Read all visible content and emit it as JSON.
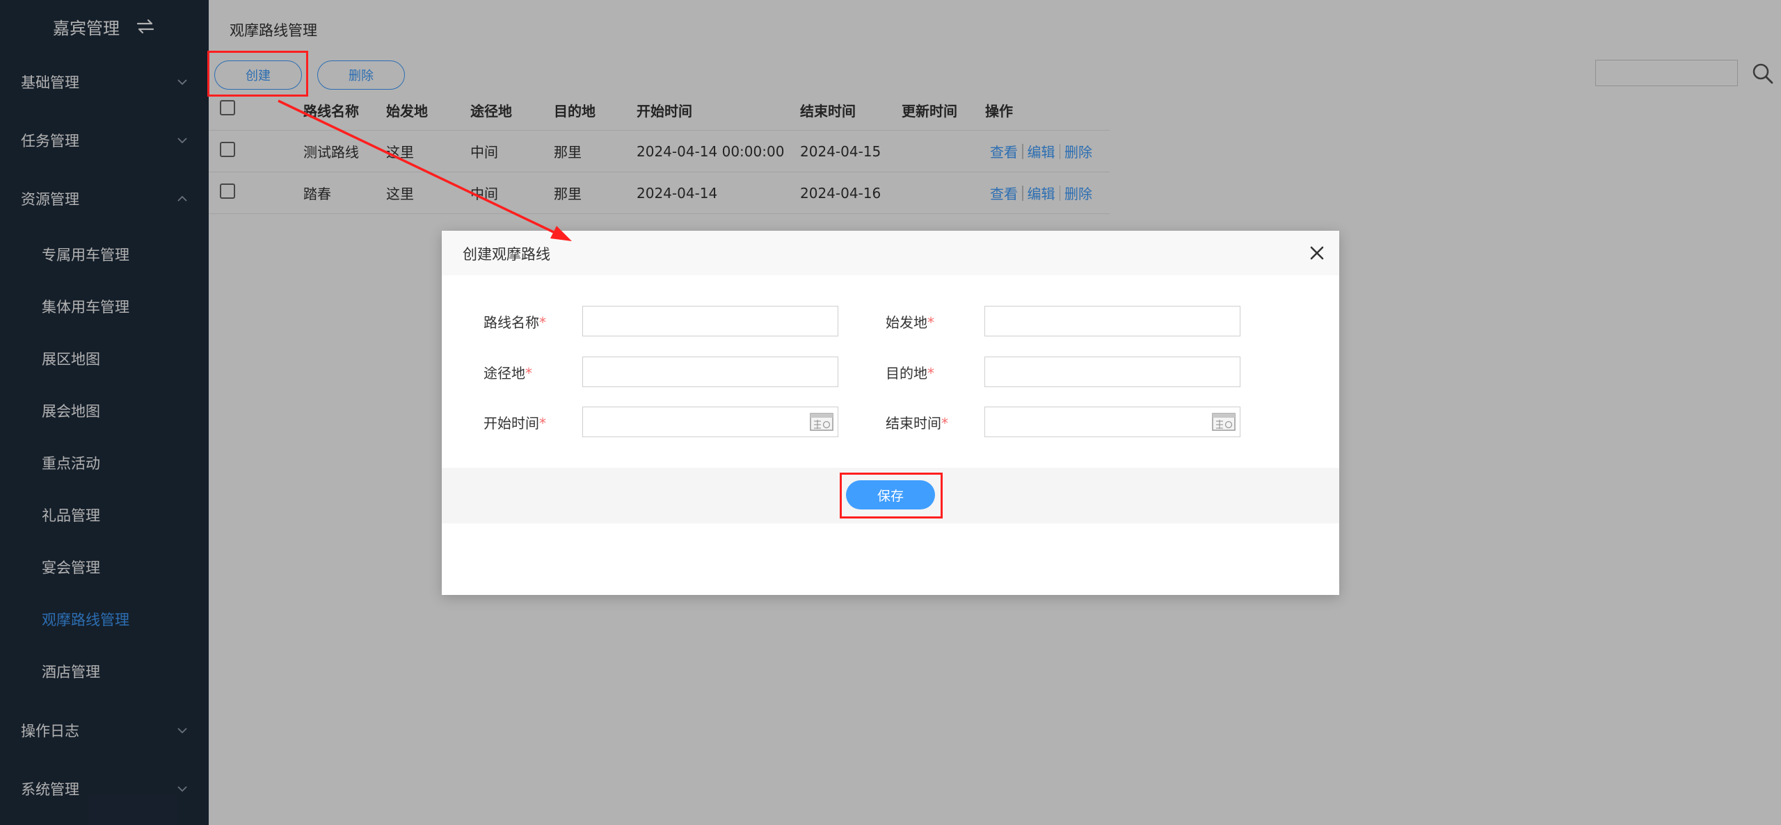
{
  "sidebar": {
    "brand": "嘉宾管理",
    "menu": [
      {
        "label": "基础管理"
      },
      {
        "label": "任务管理"
      },
      {
        "label": "资源管理"
      }
    ],
    "resource_items": [
      {
        "label": "专属用车管理"
      },
      {
        "label": "集体用车管理"
      },
      {
        "label": "展区地图"
      },
      {
        "label": "展会地图"
      },
      {
        "label": "重点活动"
      },
      {
        "label": "礼品管理"
      },
      {
        "label": "宴会管理"
      },
      {
        "label": "观摩路线管理"
      },
      {
        "label": "酒店管理"
      }
    ],
    "bottom_menu": [
      {
        "label": "操作日志"
      },
      {
        "label": "系统管理"
      }
    ]
  },
  "page": {
    "title": "观摩路线管理",
    "create_label": "创建",
    "delete_label": "删除",
    "search_value": ""
  },
  "table": {
    "headers": [
      "路线名称",
      "始发地",
      "途径地",
      "目的地",
      "开始时间",
      "结束时间",
      "更新时间",
      "操作"
    ],
    "rows": [
      [
        "测试路线",
        "这里",
        "中间",
        "那里",
        "2024-04-14 00:00:00",
        "2024-04-15",
        ""
      ],
      [
        "踏春",
        "这里",
        "中间",
        "那里",
        "2024-04-14",
        "2024-04-16",
        ""
      ]
    ],
    "actions": [
      "查看",
      "编辑",
      "删除"
    ]
  },
  "modal": {
    "title": "创建观摩路线",
    "fields": {
      "route_name": {
        "label": "路线名称",
        "value": ""
      },
      "origin": {
        "label": "始发地",
        "value": ""
      },
      "via": {
        "label": "途径地",
        "value": ""
      },
      "destination": {
        "label": "目的地",
        "value": ""
      },
      "start_time": {
        "label": "开始时间",
        "value": ""
      },
      "end_time": {
        "label": "结束时间",
        "value": ""
      }
    },
    "required_mark": "*",
    "save_label": "保存"
  },
  "colors": {
    "sidebar_bg": "#1f2d3d",
    "accent": "#409eff",
    "required": "#f56c6c",
    "annotation": "#ff1f1f"
  }
}
